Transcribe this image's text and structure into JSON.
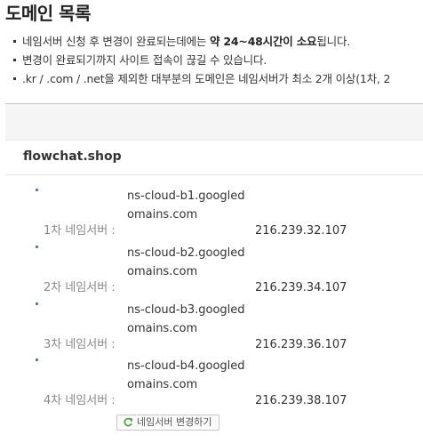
{
  "page": {
    "title": "도메인 목록"
  },
  "notices": [
    {
      "before": "네임서버 신청 후 변경이 완료되는데에는 ",
      "strong": "약 24~48시간이 소요",
      "after": "됩니다."
    },
    {
      "before": "변경이 완료되기까지 사이트 접속이 끊길 수 있습니다.",
      "strong": "",
      "after": ""
    },
    {
      "before": ".kr / .com / .net을 제외한 대부분의 도메인은 네임서버가 최소 2개 이상(1차, 2",
      "strong": "",
      "after": ""
    }
  ],
  "domain": {
    "name": "flowchat.shop",
    "nameservers": [
      {
        "label": "1차 네임서버 :",
        "host": "ns-cloud-b1.googledomains.com",
        "ip": "216.239.32.107"
      },
      {
        "label": "2차 네임서버 :",
        "host": "ns-cloud-b2.googledomains.com",
        "ip": "216.239.34.107"
      },
      {
        "label": "3차 네임서버 :",
        "host": "ns-cloud-b3.googledomains.com",
        "ip": "216.239.36.107"
      },
      {
        "label": "4차 네임서버 :",
        "host": "ns-cloud-b4.googledomains.com",
        "ip": "216.239.38.107"
      }
    ],
    "change_button": "네임서버 변경하기"
  },
  "icons": {
    "change_button_icon": "refresh-icon"
  },
  "colors": {
    "dot": "#5b7fa3",
    "label": "#888888",
    "bar": "#f5f5f5",
    "refresh_icon": "#4a9a3c"
  }
}
